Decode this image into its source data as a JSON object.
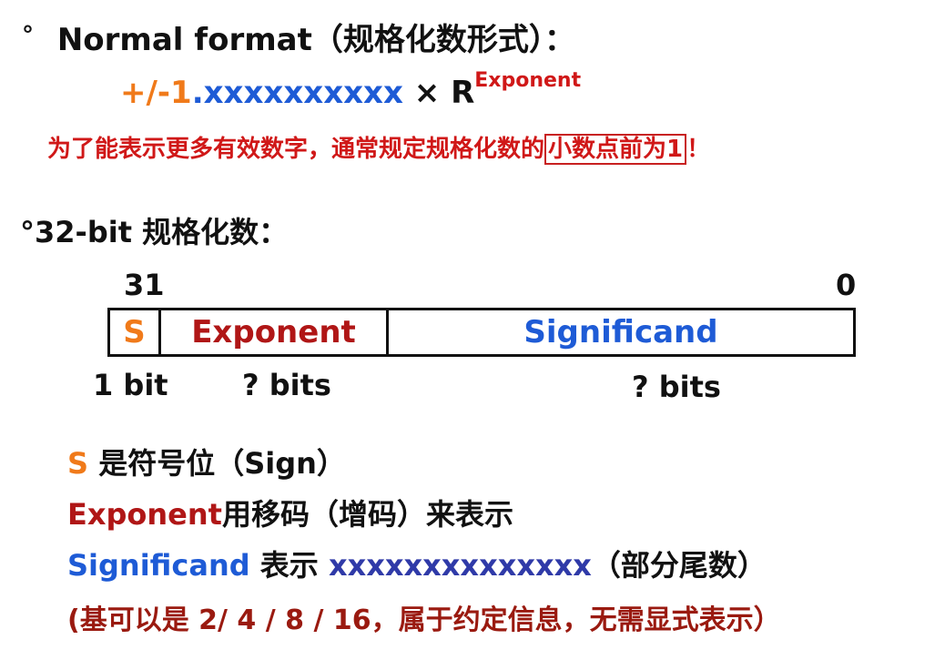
{
  "normal": {
    "bullet": "°",
    "heading": "Normal format（规格化数形式）：",
    "sign_lead": "+/-1",
    "mantissa": ".xxxxxxxxxx",
    "times_r": " × R",
    "exponent_sup": "Exponent",
    "note_main": "为了能表示更多有效数字，通常规定规格化数的",
    "note_boxed": "小数点前为1",
    "note_end": "！"
  },
  "bit32": {
    "heading": "°32-bit 规格化数：",
    "bit_high": "31",
    "bit_low": "0",
    "field_s": "S",
    "field_exponent": "Exponent",
    "field_significand": "Significand",
    "size_s": "1 bit",
    "size_exponent": "? bits",
    "size_significand": "? bits"
  },
  "notes": {
    "s_key": "S",
    "s_text": " 是符号位（Sign）",
    "exp_key": "Exponent",
    "exp_text": "用移码（增码）来表示",
    "sig_key": "Significand",
    "sig_text1": " 表示 ",
    "sig_x": "xxxxxxxxxxxxxx",
    "sig_text2": "（部分尾数）",
    "base_note": "(基可以是 2/ 4 / 8 / 16，属于约定信息，无需显式表示）"
  },
  "colors": {
    "orange": "#f07a1a",
    "blue": "#1e5bd6",
    "red": "#d01818"
  }
}
